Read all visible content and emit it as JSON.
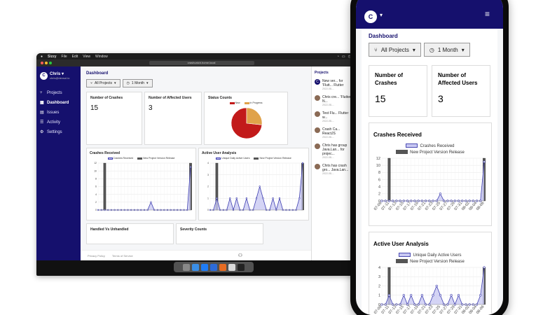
{
  "mac": {
    "menu": [
      "Sizzy",
      "File",
      "Edit",
      "View",
      "Window"
    ],
    "url": "crashcatch.home.local"
  },
  "user": {
    "initial": "C",
    "name": "Chris",
    "email": "chris@devsol.io"
  },
  "sidebar": {
    "items": [
      {
        "label": "Projects",
        "icon": "projects-icon"
      },
      {
        "label": "Dashboard",
        "icon": "dashboard-icon"
      },
      {
        "label": "Issues",
        "icon": "issues-icon"
      },
      {
        "label": "Activity",
        "icon": "activity-icon"
      },
      {
        "label": "Settings",
        "icon": "settings-icon"
      }
    ]
  },
  "dashboard": {
    "title": "Dashboard",
    "project_filter": "All Projects",
    "time_filter": "1 Month",
    "crashes_label": "Number of Crashes",
    "crashes_value": "15",
    "affected_label": "Number of Affected Users",
    "affected_value": "3",
    "status_label": "Status Counts",
    "crashes_received": "Crashes Received",
    "active_user_analysis": "Active User Analysis",
    "handled_vs_unhandled": "Handled Vs Unhandled",
    "severity_counts": "Severity Counts"
  },
  "feed": {
    "title": "Projects",
    "items": [
      {
        "text": "New ver... for 'Flutt... Flutter",
        "date": "2022-08-..."
      },
      {
        "text": "Chris cre... 'Flutter N...",
        "date": "2022-08-..."
      },
      {
        "text": "Test Flu... Flutter w...",
        "date": "2022-08-..."
      },
      {
        "text": "Crash Ca... ReactJS",
        "date": "2022-08-..."
      },
      {
        "text": "Chris has group Java.Lan... for projec...",
        "date": "2022-08-..."
      },
      {
        "text": "Chris has crash gro... Java.Lan...",
        "date": "2022-08-..."
      }
    ]
  },
  "footer": {
    "privacy": "Privacy Policy",
    "terms": "Terms of Service"
  },
  "phone": {
    "legend_crashes": "Crashes Received",
    "legend_release": "New Project Version Release",
    "legend_active": "Unique Daily Active Users"
  },
  "colors": {
    "brand": "#15106d",
    "new": "#c21a1a",
    "in_progress": "#e0a24a",
    "series_line": "#3f3fb0",
    "series_fill": "#c9c9f3",
    "release_bar": "#555555"
  },
  "chart_data": [
    {
      "type": "pie",
      "title": "Status Counts",
      "labels": [
        "New",
        "In Progress"
      ],
      "values": [
        11,
        4
      ]
    },
    {
      "type": "line",
      "title": "Crashes Received",
      "x": [
        "07-09",
        "07-10",
        "07-11",
        "07-12",
        "07-13",
        "07-14",
        "07-15",
        "07-16",
        "07-17",
        "07-18",
        "07-19",
        "07-20",
        "07-21",
        "07-22",
        "07-23",
        "07-24",
        "07-25",
        "07-26",
        "07-27",
        "07-28",
        "07-29",
        "07-30",
        "07-31",
        "08-01",
        "08-02",
        "08-03",
        "08-04",
        "08-05",
        "08-06"
      ],
      "series": [
        {
          "name": "Crashes Received",
          "values": [
            0,
            0,
            0,
            0,
            0,
            0,
            0,
            0,
            0,
            0,
            0,
            0,
            0,
            0,
            0,
            0,
            2,
            0,
            0,
            0,
            0,
            0,
            0,
            0,
            0,
            0,
            0,
            0,
            11
          ]
        },
        {
          "name": "New Project Version Release",
          "values": [
            0,
            0,
            12,
            0,
            0,
            0,
            0,
            0,
            0,
            0,
            0,
            0,
            0,
            0,
            0,
            0,
            0,
            0,
            0,
            0,
            0,
            0,
            0,
            0,
            0,
            0,
            0,
            0,
            12
          ]
        }
      ],
      "ylim": [
        0,
        12
      ],
      "yticks": [
        0,
        2,
        4,
        6,
        8,
        10,
        12
      ]
    },
    {
      "type": "line",
      "title": "Active User Analysis",
      "x": [
        "07-09",
        "07-10",
        "07-11",
        "07-12",
        "07-13",
        "07-14",
        "07-15",
        "07-16",
        "07-17",
        "07-18",
        "07-19",
        "07-20",
        "07-21",
        "07-22",
        "07-23",
        "07-24",
        "07-25",
        "07-26",
        "07-27",
        "07-28",
        "07-29",
        "07-30",
        "07-31",
        "08-01",
        "08-02",
        "08-03",
        "08-04",
        "08-05",
        "08-06"
      ],
      "series": [
        {
          "name": "Unique Daily Active Users",
          "values": [
            0,
            0,
            1,
            0,
            0,
            0,
            1,
            0,
            1,
            0,
            0,
            1,
            0,
            0,
            1,
            2,
            1,
            0,
            0,
            1,
            0,
            1,
            0,
            0,
            0,
            0,
            0,
            1,
            4
          ]
        },
        {
          "name": "New Project Version Release",
          "values": [
            0,
            0,
            4,
            0,
            0,
            0,
            0,
            0,
            0,
            0,
            0,
            0,
            0,
            0,
            0,
            0,
            0,
            0,
            0,
            0,
            0,
            0,
            0,
            0,
            0,
            0,
            0,
            0,
            4
          ]
        }
      ],
      "ylim": [
        0,
        4
      ],
      "yticks": [
        0,
        1,
        2,
        3,
        4
      ]
    }
  ]
}
